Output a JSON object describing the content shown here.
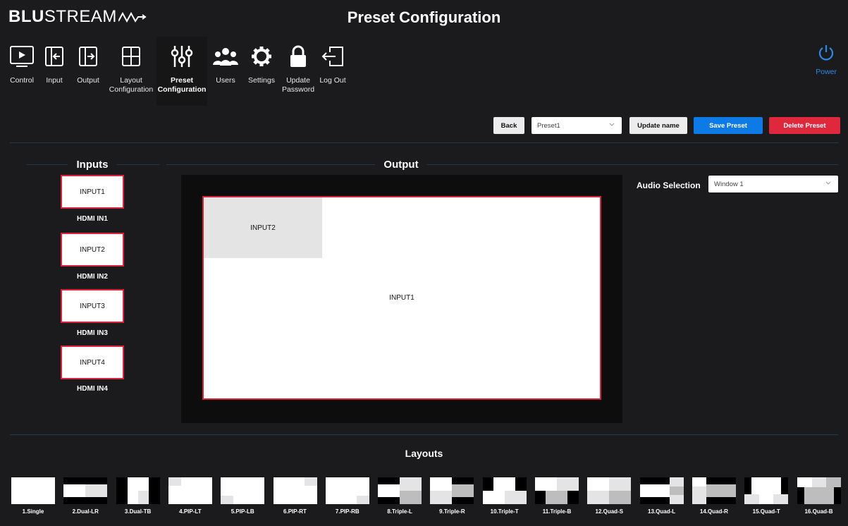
{
  "brand": {
    "bold": "BLU",
    "light": "STREAM"
  },
  "page_title": "Preset Configuration",
  "nav": [
    {
      "label": "Control",
      "icon": "monitor-play-icon"
    },
    {
      "label": "Input",
      "icon": "input-arrow-icon"
    },
    {
      "label": "Output",
      "icon": "output-arrow-icon"
    },
    {
      "label": "Layout\nConfiguration",
      "icon": "grid-layout-icon"
    },
    {
      "label": "Preset\nConfiguration",
      "icon": "sliders-icon",
      "active": true
    },
    {
      "label": "Users",
      "icon": "users-icon"
    },
    {
      "label": "Settings",
      "icon": "gear-icon"
    },
    {
      "label": "Update\nPassword",
      "icon": "lock-icon"
    },
    {
      "label": "Log Out",
      "icon": "logout-icon"
    }
  ],
  "power_label": "Power",
  "toolbar": {
    "back": "Back",
    "preset_selected": "Preset1",
    "update_name": "Update name",
    "save": "Save Preset",
    "delete": "Delete Preset"
  },
  "inputs_title": "Inputs",
  "output_title": "Output",
  "inputs": [
    {
      "label": "INPUT1",
      "name": "HDMI IN1"
    },
    {
      "label": "INPUT2",
      "name": "HDMI IN2"
    },
    {
      "label": "INPUT3",
      "name": "HDMI IN3"
    },
    {
      "label": "INPUT4",
      "name": "HDMI IN4"
    }
  ],
  "output": {
    "window_main": "INPUT1",
    "window_pip": "INPUT2"
  },
  "audio": {
    "label": "Audio Selection",
    "selected": "Window 1"
  },
  "layouts_title": "Layouts",
  "layouts": [
    "1.Single",
    "2.Dual-LR",
    "3.Dual-TB",
    "4.PIP-LT",
    "5.PIP-LB",
    "6.PIP-RT",
    "7.PIP-RB",
    "8.Triple-L",
    "9.Triple-R",
    "10.Triple-T",
    "11.Triple-B",
    "12.Quad-S",
    "13.Quad-L",
    "14.Quad-R",
    "15.Quad-T",
    "16.Quad-B"
  ],
  "colors": {
    "accent_blue": "#0d7ae6",
    "accent_red": "#e0283c",
    "background": "#1b1b1d"
  }
}
